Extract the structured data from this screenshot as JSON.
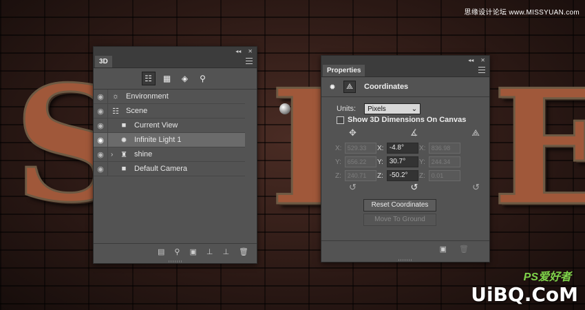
{
  "watermark": {
    "top": "思缘设计论坛 www.MISSYUAN.com",
    "ps": "PS爱好者",
    "bottom": "UiBQ.CoM"
  },
  "artwork": {
    "letters": [
      "S",
      "I",
      "E"
    ]
  },
  "panel3d": {
    "title": "3D",
    "collapse": "◂◂",
    "close": "✕",
    "filters": [
      {
        "name": "whole-scene-filter",
        "icon": "scene-tree-icon",
        "glyph": "☷"
      },
      {
        "name": "meshes-filter",
        "icon": "mesh-icon",
        "glyph": "▦"
      },
      {
        "name": "materials-filter",
        "icon": "material-icon",
        "glyph": "◈"
      },
      {
        "name": "lights-filter",
        "icon": "bulb-icon",
        "glyph": "⚲"
      }
    ],
    "layers": [
      {
        "label": "Environment",
        "icon": "environment-icon",
        "glyph": "☼",
        "indent": 0,
        "selected": false
      },
      {
        "label": "Scene",
        "icon": "scene-icon",
        "glyph": "☷",
        "indent": 0,
        "selected": false
      },
      {
        "label": "Current View",
        "icon": "camera-icon",
        "glyph": "■",
        "indent": 1,
        "selected": false
      },
      {
        "label": "Infinite Light 1",
        "icon": "infinite-light-icon",
        "glyph": "✹",
        "indent": 1,
        "selected": true
      },
      {
        "label": "shine",
        "icon": "mesh-icon",
        "glyph": "♜",
        "indent": 1,
        "expand": "›",
        "selected": false
      },
      {
        "label": "Default Camera",
        "icon": "camera-icon",
        "glyph": "■",
        "indent": 1,
        "selected": false
      }
    ],
    "footer_icons": [
      {
        "name": "render-button",
        "glyph": "▤"
      },
      {
        "name": "new-light-button",
        "glyph": "⚲"
      },
      {
        "name": "add-constraint-button",
        "glyph": "▣"
      },
      {
        "name": "drop-to-ground-button",
        "glyph": "⊥"
      },
      {
        "name": "split-extrusion-button",
        "glyph": "⊥"
      },
      {
        "name": "delete-button",
        "glyph": "🗑"
      }
    ]
  },
  "props": {
    "title": "Properties",
    "collapse": "◂◂",
    "close": "✕",
    "section": "Coordinates",
    "units_label": "Units:",
    "units_value": "Pixels",
    "show_dims_label": "Show 3D Dimensions On Canvas",
    "rows": [
      {
        "axis": "X:",
        "pos": "529.33",
        "rot": "-4.8°",
        "scale": "836.98"
      },
      {
        "axis": "Y:",
        "pos": "656.22",
        "rot": "30.7°",
        "scale": "244.34"
      },
      {
        "axis": "Z:",
        "pos": "240.71",
        "rot": "-50.2°",
        "scale": "0.01"
      }
    ],
    "reset_button": "Reset Coordinates",
    "ground_button": "Move To Ground"
  }
}
